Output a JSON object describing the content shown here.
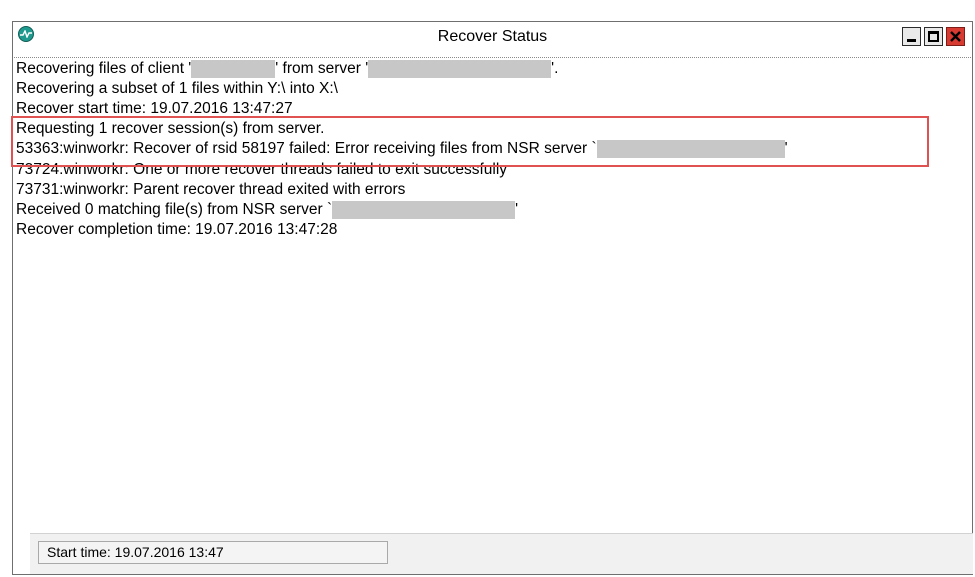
{
  "window": {
    "title": "Recover Status"
  },
  "log": {
    "lines": [
      {
        "segments": [
          "Recovering files of client '",
          "' from server '",
          "'."
        ]
      },
      {
        "text": "Recovering a subset of 1 files within Y:\\ into X:\\"
      },
      {
        "text": "Recover start time: 19.07.2016 13:47:27"
      },
      {
        "text": "Requesting 1 recover session(s) from server."
      },
      {
        "segments": [
          "53363:winworkr: Recover of rsid 58197 failed: Error receiving files from NSR server `",
          "'"
        ]
      },
      {
        "text": "73724:winworkr: One or more recover threads failed to exit successfully"
      },
      {
        "text": "73731:winworkr: Parent recover thread exited with errors"
      },
      {
        "segments": [
          "Received 0 matching file(s) from NSR server `",
          "'"
        ]
      },
      {
        "text": "Recover completion time: 19.07.2016 13:47:28"
      }
    ]
  },
  "status_bar": {
    "text": "Start time: 19.07.2016 13:47"
  },
  "colors": {
    "highlight": "#e05252",
    "redaction": "#c7c7c7",
    "close_button": "#d73a31"
  },
  "icons": [
    "app-status-icon",
    "minimize-icon",
    "maximize-icon",
    "close-icon"
  ]
}
